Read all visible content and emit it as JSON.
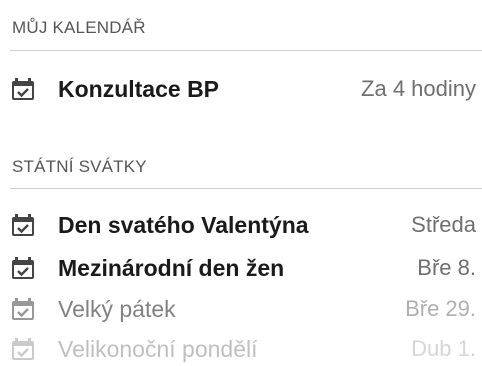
{
  "my_calendar": {
    "heading": "MŮJ KALENDÁŘ",
    "events": [
      {
        "title": "Konzultace BP",
        "when": "Za 4 hodiny",
        "icon": "calendar-check-icon"
      }
    ]
  },
  "holidays": {
    "heading": "STÁTNÍ SVÁTKY",
    "events": [
      {
        "title": "Den svatého Valentýna",
        "when": "Středa",
        "icon": "calendar-check-icon"
      },
      {
        "title": "Mezinárodní den žen",
        "when": "Bře 8.",
        "icon": "calendar-check-icon"
      },
      {
        "title": "Velký pátek",
        "when": "Bře 29.",
        "icon": "calendar-check-icon"
      },
      {
        "title": "Velikonoční pondělí",
        "when": "Dub 1.",
        "icon": "calendar-check-icon"
      }
    ]
  },
  "colors": {
    "icon": "#444444",
    "text": "#1a1a1a",
    "secondary_text": "#6f6f6f",
    "header_text": "#555555",
    "divider": "#cfcfcf"
  }
}
